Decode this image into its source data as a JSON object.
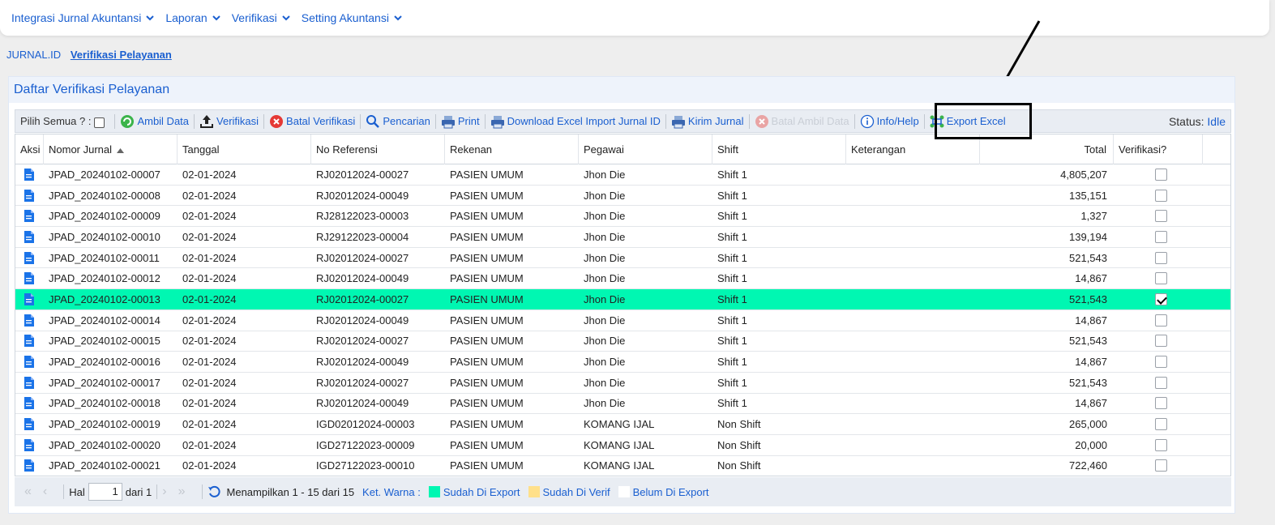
{
  "nav": {
    "items": [
      {
        "label": "Integrasi Jurnal Akuntansi"
      },
      {
        "label": "Laporan"
      },
      {
        "label": "Verifikasi"
      },
      {
        "label": "Setting Akuntansi"
      }
    ]
  },
  "breadcrumb": {
    "root": "JURNAL.ID",
    "current": "Verifikasi Pelayanan"
  },
  "panel": {
    "title": "Daftar Verifikasi Pelayanan"
  },
  "toolbar": {
    "select_all_label": "Pilih Semua ? :",
    "ambil_data": "Ambil Data",
    "verifikasi": "Verifikasi",
    "batal_verifikasi": "Batal Verifikasi",
    "pencarian": "Pencarian",
    "print": "Print",
    "download_excel": "Download Excel Import Jurnal ID",
    "kirim_jurnal": "Kirim Jurnal",
    "batal_ambil_data": "Batal Ambil Data",
    "info_help": "Info/Help",
    "export_excel": "Export Excel",
    "status_label": "Status:",
    "status_value": "Idle"
  },
  "columns": {
    "aksi": "Aksi",
    "nomor": "Nomor Jurnal",
    "tanggal": "Tanggal",
    "referensi": "No Referensi",
    "rekanan": "Rekenan",
    "pegawai": "Pegawai",
    "shift": "Shift",
    "keterangan": "Keterangan",
    "total": "Total",
    "verifikasi": "Verifikasi?"
  },
  "rows": [
    {
      "nomor": "JPAD_20240102-00007",
      "tanggal": "02-01-2024",
      "ref": "RJ02012024-00027",
      "rekanan": "PASIEN UMUM",
      "pegawai": "Jhon Die",
      "shift": "Shift 1",
      "ket": "",
      "total": "4,805,207",
      "verified": false,
      "selected": false
    },
    {
      "nomor": "JPAD_20240102-00008",
      "tanggal": "02-01-2024",
      "ref": "RJ02012024-00049",
      "rekanan": "PASIEN UMUM",
      "pegawai": "Jhon Die",
      "shift": "Shift 1",
      "ket": "",
      "total": "135,151",
      "verified": false,
      "selected": false
    },
    {
      "nomor": "JPAD_20240102-00009",
      "tanggal": "02-01-2024",
      "ref": "RJ28122023-00003",
      "rekanan": "PASIEN UMUM",
      "pegawai": "Jhon Die",
      "shift": "Shift 1",
      "ket": "",
      "total": "1,327",
      "verified": false,
      "selected": false
    },
    {
      "nomor": "JPAD_20240102-00010",
      "tanggal": "02-01-2024",
      "ref": "RJ29122023-00004",
      "rekanan": "PASIEN UMUM",
      "pegawai": "Jhon Die",
      "shift": "Shift 1",
      "ket": "",
      "total": "139,194",
      "verified": false,
      "selected": false
    },
    {
      "nomor": "JPAD_20240102-00011",
      "tanggal": "02-01-2024",
      "ref": "RJ02012024-00027",
      "rekanan": "PASIEN UMUM",
      "pegawai": "Jhon Die",
      "shift": "Shift 1",
      "ket": "",
      "total": "521,543",
      "verified": false,
      "selected": false
    },
    {
      "nomor": "JPAD_20240102-00012",
      "tanggal": "02-01-2024",
      "ref": "RJ02012024-00049",
      "rekanan": "PASIEN UMUM",
      "pegawai": "Jhon Die",
      "shift": "Shift 1",
      "ket": "",
      "total": "14,867",
      "verified": false,
      "selected": false
    },
    {
      "nomor": "JPAD_20240102-00013",
      "tanggal": "02-01-2024",
      "ref": "RJ02012024-00027",
      "rekanan": "PASIEN UMUM",
      "pegawai": "Jhon Die",
      "shift": "Shift 1",
      "ket": "",
      "total": "521,543",
      "verified": true,
      "selected": true
    },
    {
      "nomor": "JPAD_20240102-00014",
      "tanggal": "02-01-2024",
      "ref": "RJ02012024-00049",
      "rekanan": "PASIEN UMUM",
      "pegawai": "Jhon Die",
      "shift": "Shift 1",
      "ket": "",
      "total": "14,867",
      "verified": false,
      "selected": false
    },
    {
      "nomor": "JPAD_20240102-00015",
      "tanggal": "02-01-2024",
      "ref": "RJ02012024-00027",
      "rekanan": "PASIEN UMUM",
      "pegawai": "Jhon Die",
      "shift": "Shift 1",
      "ket": "",
      "total": "521,543",
      "verified": false,
      "selected": false
    },
    {
      "nomor": "JPAD_20240102-00016",
      "tanggal": "02-01-2024",
      "ref": "RJ02012024-00049",
      "rekanan": "PASIEN UMUM",
      "pegawai": "Jhon Die",
      "shift": "Shift 1",
      "ket": "",
      "total": "14,867",
      "verified": false,
      "selected": false
    },
    {
      "nomor": "JPAD_20240102-00017",
      "tanggal": "02-01-2024",
      "ref": "RJ02012024-00027",
      "rekanan": "PASIEN UMUM",
      "pegawai": "Jhon Die",
      "shift": "Shift 1",
      "ket": "",
      "total": "521,543",
      "verified": false,
      "selected": false
    },
    {
      "nomor": "JPAD_20240102-00018",
      "tanggal": "02-01-2024",
      "ref": "RJ02012024-00049",
      "rekanan": "PASIEN UMUM",
      "pegawai": "Jhon Die",
      "shift": "Shift 1",
      "ket": "",
      "total": "14,867",
      "verified": false,
      "selected": false
    },
    {
      "nomor": "JPAD_20240102-00019",
      "tanggal": "02-01-2024",
      "ref": "IGD02012024-00003",
      "rekanan": "PASIEN UMUM",
      "pegawai": "KOMANG IJAL",
      "shift": "Non Shift",
      "ket": "",
      "total": "265,000",
      "verified": false,
      "selected": false
    },
    {
      "nomor": "JPAD_20240102-00020",
      "tanggal": "02-01-2024",
      "ref": "IGD27122023-00009",
      "rekanan": "PASIEN UMUM",
      "pegawai": "KOMANG IJAL",
      "shift": "Non Shift",
      "ket": "",
      "total": "20,000",
      "verified": false,
      "selected": false
    },
    {
      "nomor": "JPAD_20240102-00021",
      "tanggal": "02-01-2024",
      "ref": "IGD27122023-00010",
      "rekanan": "PASIEN UMUM",
      "pegawai": "KOMANG IJAL",
      "shift": "Non Shift",
      "ket": "",
      "total": "722,460",
      "verified": false,
      "selected": false
    }
  ],
  "pager": {
    "hal_label": "Hal",
    "page": "1",
    "of_label": "dari 1",
    "display_text": "Menampilkan 1 - 15 dari 15",
    "ket_warna": "Ket. Warna :",
    "legend": [
      {
        "label": "Sudah Di Export",
        "color": "#00f7b2"
      },
      {
        "label": "Sudah Di Verif",
        "color": "#ffe08a"
      },
      {
        "label": "Belum Di Export",
        "color": "#ffffff"
      }
    ]
  },
  "colors": {
    "accent": "#1a5fd0",
    "selected_row": "#00f7b2"
  }
}
